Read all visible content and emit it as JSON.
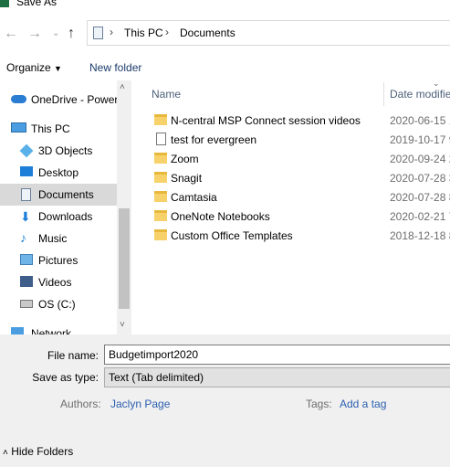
{
  "window": {
    "title": "Save As"
  },
  "address": {
    "segments": [
      "This PC",
      "Documents"
    ]
  },
  "toolbar": {
    "organize": "Organize",
    "new_folder": "New folder"
  },
  "nav": {
    "items": [
      {
        "label": "OneDrive - Power",
        "icon": "onedrive-icon"
      },
      {
        "label": "This PC",
        "icon": "computer-icon"
      },
      {
        "label": "3D Objects",
        "icon": "3d-objects-icon"
      },
      {
        "label": "Desktop",
        "icon": "desktop-icon"
      },
      {
        "label": "Documents",
        "icon": "documents-icon"
      },
      {
        "label": "Downloads",
        "icon": "downloads-icon"
      },
      {
        "label": "Music",
        "icon": "music-icon"
      },
      {
        "label": "Pictures",
        "icon": "pictures-icon"
      },
      {
        "label": "Videos",
        "icon": "videos-icon"
      },
      {
        "label": "OS (C:)",
        "icon": "drive-icon"
      },
      {
        "label": "Network",
        "icon": "network-icon"
      }
    ]
  },
  "files": {
    "columns": {
      "name": "Name",
      "date": "Date modifie"
    },
    "rows": [
      {
        "name": "N-central MSP Connect session videos",
        "date": "2020-06-15 1",
        "type": "shortcut-folder"
      },
      {
        "name": "test for evergreen",
        "date": "2019-10-17 9",
        "type": "file"
      },
      {
        "name": "Zoom",
        "date": "2020-09-24 2",
        "type": "folder"
      },
      {
        "name": "Snagit",
        "date": "2020-07-28 3",
        "type": "folder"
      },
      {
        "name": "Camtasia",
        "date": "2020-07-28 8",
        "type": "folder"
      },
      {
        "name": "OneNote Notebooks",
        "date": "2020-02-21 7",
        "type": "folder"
      },
      {
        "name": "Custom Office Templates",
        "date": "2018-12-18 8",
        "type": "folder"
      }
    ]
  },
  "save": {
    "file_name_label": "File name:",
    "file_name_value": "Budgetimport2020",
    "save_type_label": "Save as type:",
    "save_type_value": "Text (Tab delimited)",
    "authors_label": "Authors:",
    "authors_value": "Jaclyn Page",
    "tags_label": "Tags:",
    "tags_value": "Add a tag",
    "hide_folders": "Hide Folders"
  },
  "colors": {
    "excel_green": "#1d6f42",
    "link_blue": "#2c5fb0",
    "folder_yellow": "#f7d26a"
  }
}
